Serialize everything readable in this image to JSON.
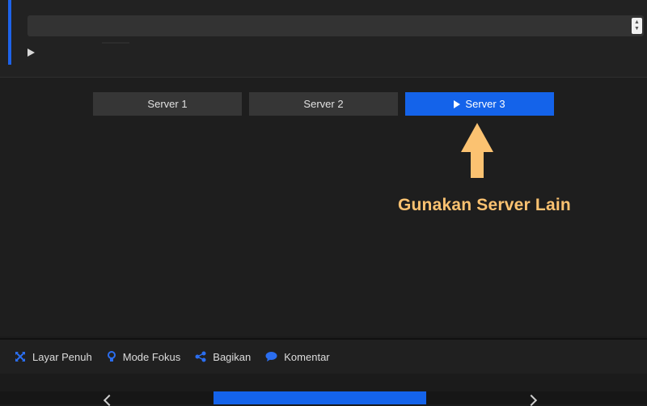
{
  "servers": [
    {
      "label": "Server 1",
      "active": false
    },
    {
      "label": "Server 2",
      "active": false
    },
    {
      "label": "Server 3",
      "active": true
    }
  ],
  "annotation": {
    "text": "Gunakan Server Lain",
    "color": "#fbc271"
  },
  "toolbar": {
    "items": [
      {
        "label": "Layar Penuh",
        "icon": "fullscreen-icon"
      },
      {
        "label": "Mode Fokus",
        "icon": "lightbulb-icon"
      },
      {
        "label": "Bagikan",
        "icon": "share-icon"
      },
      {
        "label": "Komentar",
        "icon": "comment-icon"
      }
    ]
  },
  "colors": {
    "accent": "#1463ea",
    "background": "#1b1b1b",
    "annotation": "#fbc271"
  }
}
